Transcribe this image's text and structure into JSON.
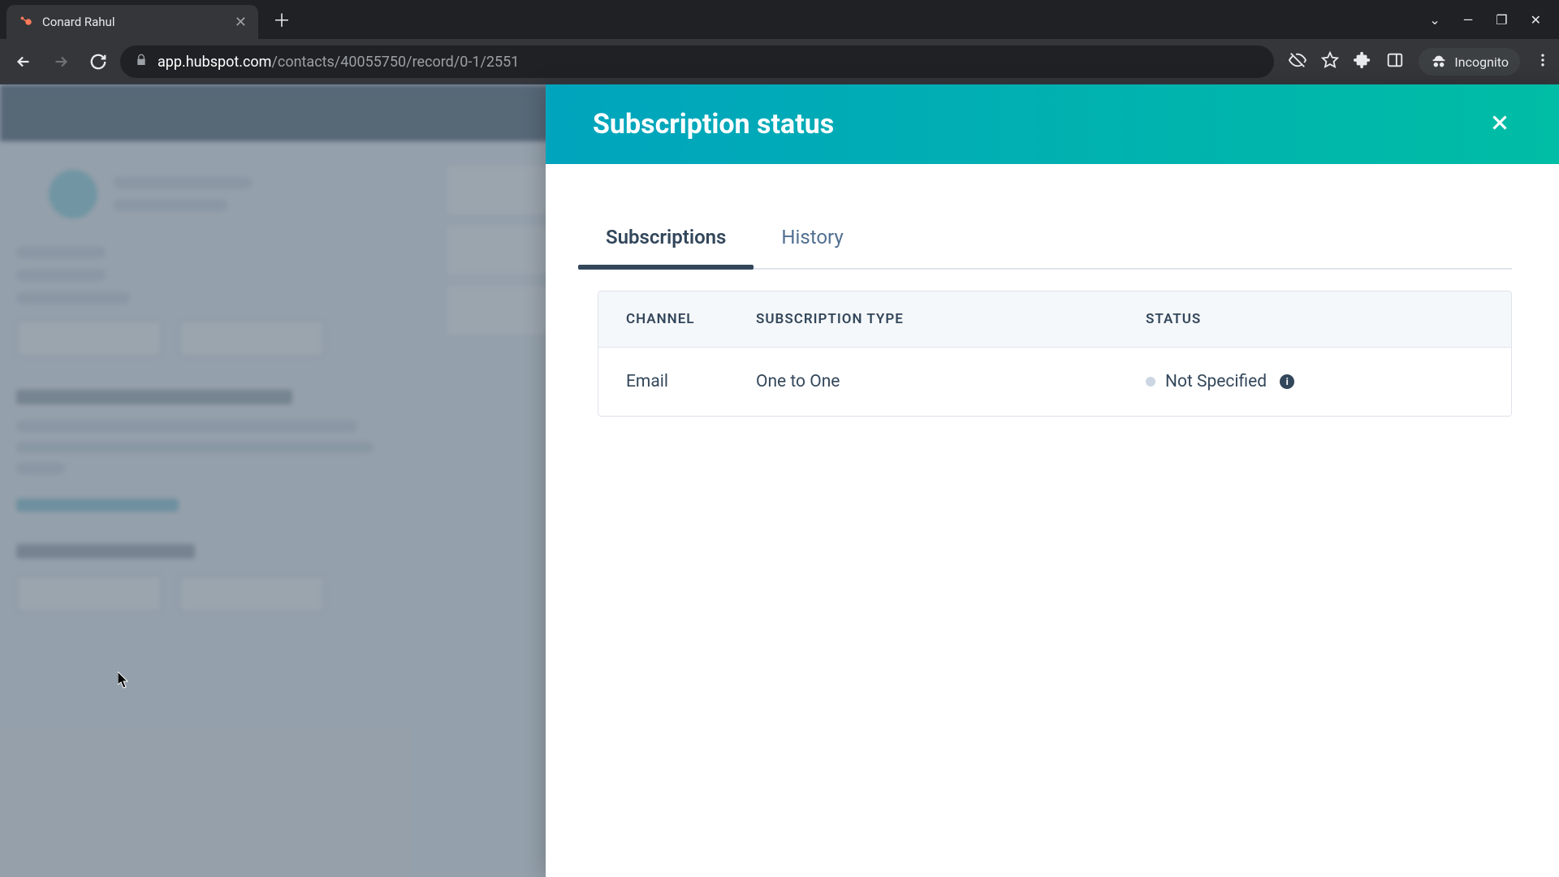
{
  "browser": {
    "tab_title": "Conard Rahul",
    "url_domain": "app.hubspot.com",
    "url_path": "/contacts/40055750/record/0-1/2551",
    "incognito_label": "Incognito"
  },
  "panel": {
    "title": "Subscription status",
    "tabs": {
      "subscriptions": "Subscriptions",
      "history": "History"
    },
    "table": {
      "headers": {
        "channel": "CHANNEL",
        "type": "SUBSCRIPTION TYPE",
        "status": "STATUS"
      },
      "rows": [
        {
          "channel": "Email",
          "type": "One to One",
          "status": "Not Specified"
        }
      ]
    }
  }
}
